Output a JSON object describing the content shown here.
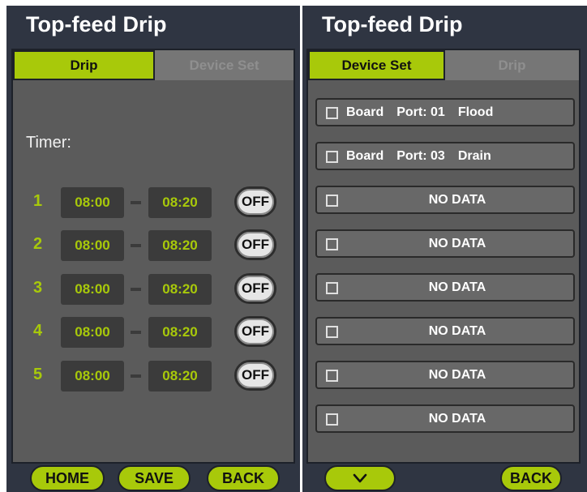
{
  "left": {
    "title": "Top-feed Drip",
    "tabs": [
      "Drip",
      "Device Set"
    ],
    "timer_label": "Timer:",
    "timers": [
      {
        "num": "1",
        "start": "08:00",
        "end": "08:20",
        "state": "OFF"
      },
      {
        "num": "2",
        "start": "08:00",
        "end": "08:20",
        "state": "OFF"
      },
      {
        "num": "3",
        "start": "08:00",
        "end": "08:20",
        "state": "OFF"
      },
      {
        "num": "4",
        "start": "08:00",
        "end": "08:20",
        "state": "OFF"
      },
      {
        "num": "5",
        "start": "08:00",
        "end": "08:20",
        "state": "OFF"
      }
    ],
    "buttons": {
      "home": "HOME",
      "save": "SAVE",
      "back": "BACK"
    }
  },
  "right": {
    "title": "Top-feed Drip",
    "tabs": [
      "Device Set",
      "Drip"
    ],
    "devices": [
      {
        "name": "Board",
        "port": "Port: 01",
        "mode": "Flood",
        "checked": false
      },
      {
        "name": "Board",
        "port": "Port: 03",
        "mode": "Drain",
        "checked": false
      },
      {
        "label": "NO DATA",
        "checked": false
      },
      {
        "label": "NO DATA",
        "checked": false
      },
      {
        "label": "NO DATA",
        "checked": false
      },
      {
        "label": "NO DATA",
        "checked": false
      },
      {
        "label": "NO DATA",
        "checked": false
      },
      {
        "label": "NO DATA",
        "checked": false
      }
    ],
    "buttons": {
      "down_icon": "chevron-down-icon",
      "back": "BACK"
    }
  },
  "colors": {
    "accent": "#a8c90a",
    "panel_bg": "#2f3542",
    "content_bg": "#5b5b5b",
    "inactive_tab": "#767676"
  }
}
